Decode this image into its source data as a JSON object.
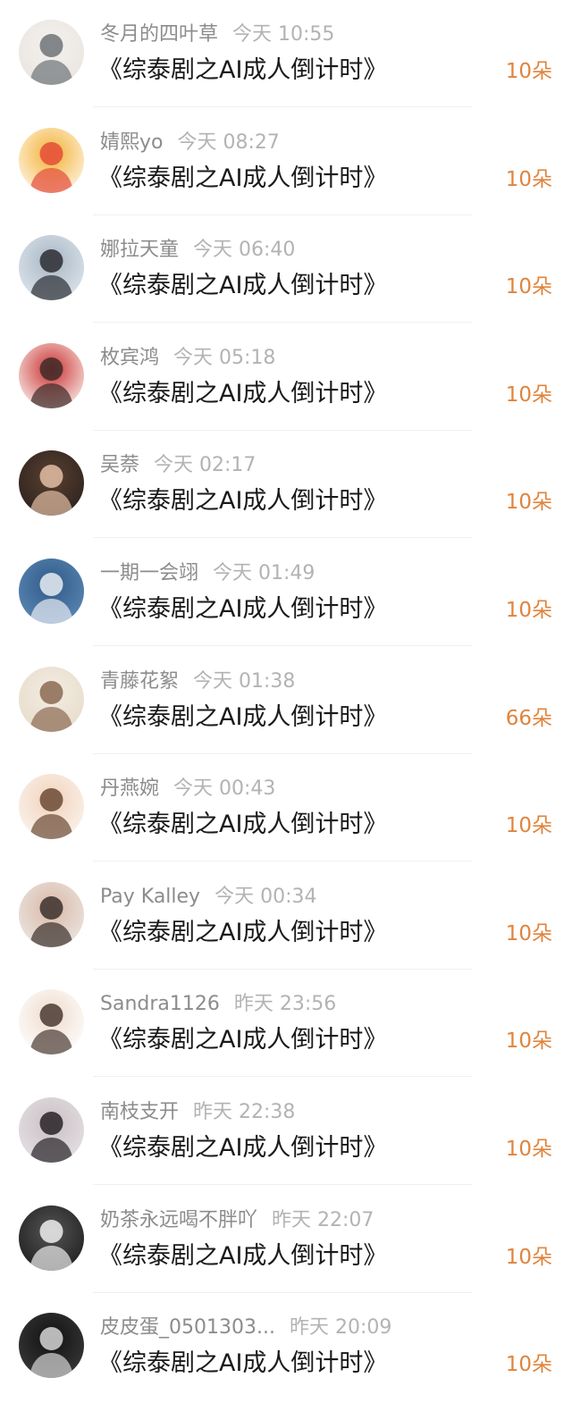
{
  "colors": {
    "name": "#8c8c8c",
    "time": "#b3b3b3",
    "title": "#1a1a1a",
    "count_accent": "#e0843c",
    "divider": "#f0f0f0"
  },
  "entries": [
    {
      "name": "冬月的四叶草",
      "time": "今天 10:55",
      "title": "《综泰剧之AI成人倒计时》",
      "count": "10朵",
      "avatar": "cat-avatar",
      "avatar_colors": [
        "#e9e4df",
        "#6e7378",
        "#f4f1ee"
      ]
    },
    {
      "name": "婧熙yo",
      "time": "今天 08:27",
      "title": "《综泰剧之AI成人倒计时》",
      "count": "10朵",
      "avatar": "dragon-cartoon-avatar",
      "avatar_colors": [
        "#fff6ea",
        "#e44c3a",
        "#f2b234"
      ]
    },
    {
      "name": "娜拉天童",
      "time": "今天 06:40",
      "title": "《综泰剧之AI成人倒计时》",
      "count": "10朵",
      "avatar": "couple-photo-avatar",
      "avatar_colors": [
        "#dfe7ee",
        "#2b2d33",
        "#a8b6c4"
      ]
    },
    {
      "name": "枚宾鸿",
      "time": "今天 05:18",
      "title": "《综泰剧之AI成人倒计时》",
      "count": "10朵",
      "avatar": "chibi-character-avatar",
      "avatar_colors": [
        "#fbf3ef",
        "#3d2b28",
        "#c92f2f"
      ]
    },
    {
      "name": "吴萘",
      "time": "今天 02:17",
      "title": "《综泰剧之AI成人倒计时》",
      "count": "10朵",
      "avatar": "woman-portrait-avatar",
      "avatar_colors": [
        "#2a211e",
        "#e2bfa4",
        "#5a4030"
      ]
    },
    {
      "name": "一期一会翊",
      "time": "今天 01:49",
      "title": "《综泰剧之AI成人倒计时》",
      "count": "10朵",
      "avatar": "seaside-photo-avatar",
      "avatar_colors": [
        "#5d89b8",
        "#e8edf2",
        "#2f5a86"
      ]
    },
    {
      "name": "青藤花絮",
      "time": "今天 01:38",
      "title": "《综泰剧之AI成人倒计时》",
      "count": "66朵",
      "avatar": "couple-hug-avatar",
      "avatar_colors": [
        "#e7dccb",
        "#8b6a52",
        "#f3ece2"
      ]
    },
    {
      "name": "丹燕婉",
      "time": "今天 00:43",
      "title": "《综泰剧之AI成人倒计时》",
      "count": "10朵",
      "avatar": "cartoon-boy-avatar",
      "avatar_colors": [
        "#faf5ef",
        "#6b4a35",
        "#f2d2bb"
      ]
    },
    {
      "name": "Pay Kalley",
      "time": "今天 00:34",
      "title": "《综泰剧之AI成人倒计时》",
      "count": "10朵",
      "avatar": "girl-flower-avatar",
      "avatar_colors": [
        "#ece7e3",
        "#3b2f2b",
        "#d9b9a7"
      ]
    },
    {
      "name": "Sandra1126",
      "time": "昨天 23:56",
      "title": "《综泰剧之AI成人倒计时》",
      "count": "10朵",
      "avatar": "anime-boy-sign-avatar",
      "avatar_colors": [
        "#ffffff",
        "#4a3a33",
        "#eedccd"
      ]
    },
    {
      "name": "南枝支开",
      "time": "昨天 22:38",
      "title": "《综泰剧之AI成人倒计时》",
      "count": "10朵",
      "avatar": "man-portrait-avatar",
      "avatar_colors": [
        "#e6e3e6",
        "#272226",
        "#c9bfc3"
      ]
    },
    {
      "name": "奶茶永远喝不胖吖",
      "time": "昨天 22:07",
      "title": "《综泰剧之AI成人倒计时》",
      "count": "10朵",
      "avatar": "black-white-cat-avatar",
      "avatar_colors": [
        "#1d1d1f",
        "#eeeeee",
        "#555555"
      ]
    },
    {
      "name": "皮皮蛋_0501303...",
      "time": "昨天 20:09",
      "title": "《综泰剧之AI成人倒计时》",
      "count": "10朵",
      "avatar": "mono-portrait-avatar",
      "avatar_colors": [
        "#3a3a3a",
        "#d6d6d6",
        "#111111"
      ]
    }
  ]
}
